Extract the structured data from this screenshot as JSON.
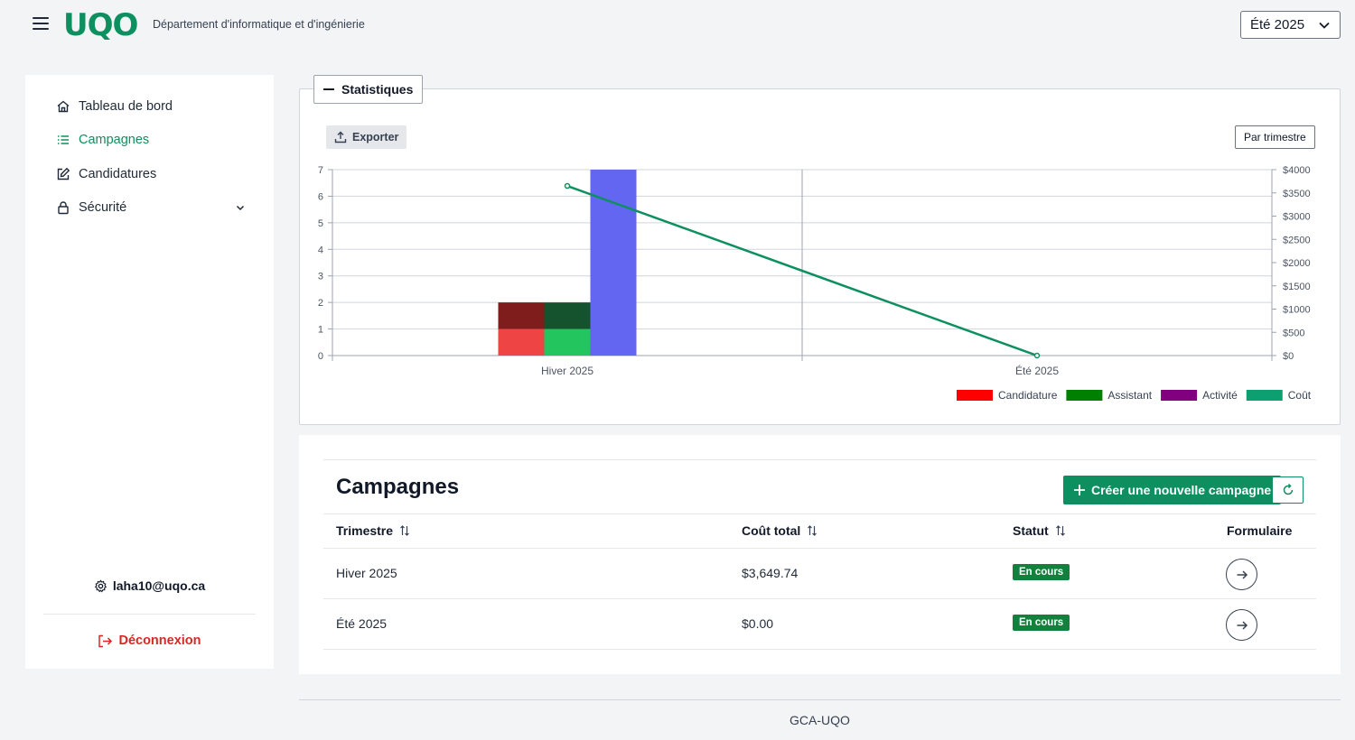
{
  "header": {
    "logo_text": "UQO",
    "department": "Département d'informatique et d'ingénierie",
    "term_selected": "Été 2025"
  },
  "sidebar": {
    "items": [
      {
        "label": "Tableau de bord",
        "icon": "home-icon"
      },
      {
        "label": "Campagnes",
        "icon": "list-icon",
        "active": true
      },
      {
        "label": "Candidatures",
        "icon": "edit-icon"
      },
      {
        "label": "Sécurité",
        "icon": "lock-icon"
      }
    ],
    "user_email": "laha10@uqo.ca",
    "logout_label": "Déconnexion"
  },
  "stats": {
    "legend_label": "Statistiques",
    "export_label": "Exporter",
    "period_label": "Par trimestre"
  },
  "chart_data": {
    "type": "bar",
    "categories": [
      "Hiver 2025",
      "Été 2025"
    ],
    "y_left": {
      "ylim": [
        0,
        7
      ],
      "ticks": [
        "0",
        "1",
        "2",
        "3",
        "4",
        "5",
        "6",
        "7"
      ]
    },
    "y_right": {
      "ylim": [
        0,
        4000
      ],
      "ticks": [
        "$0",
        "$500",
        "$1000",
        "$1500",
        "$2000",
        "$2500",
        "$3000",
        "$3500",
        "$4000"
      ]
    },
    "series": [
      {
        "name": "Candidature",
        "type": "bar",
        "color": "#ef4444",
        "stack": [
          {
            "category": 0,
            "values": [
              1,
              1
            ],
            "colors": [
              "#ef4444",
              "#7f1d1d"
            ]
          }
        ]
      },
      {
        "name": "Assistant",
        "type": "bar",
        "color": "#22c55e",
        "stack": [
          {
            "category": 0,
            "values": [
              1,
              1
            ],
            "colors": [
              "#22c55e",
              "#14532d"
            ]
          }
        ]
      },
      {
        "name": "Activité",
        "type": "bar",
        "color": "#6366f1",
        "values": [
          7,
          0
        ]
      },
      {
        "name": "Coût",
        "type": "line",
        "axis": "right",
        "color": "#0d8f5f",
        "values": [
          3649.74,
          0
        ]
      }
    ],
    "legend": [
      {
        "label": "Candidature",
        "color": "#ff0000"
      },
      {
        "label": "Assistant",
        "color": "#008000"
      },
      {
        "label": "Activité",
        "color": "#800080"
      },
      {
        "label": "Coût",
        "color": "#0d9f6f"
      }
    ],
    "legend_position": "bottom-right",
    "grid": true
  },
  "campaigns": {
    "title": "Campagnes",
    "create_label": "Créer une nouvelle campagne",
    "columns": {
      "trimestre": "Trimestre",
      "cout": "Coût total",
      "statut": "Statut",
      "formulaire": "Formulaire"
    },
    "rows": [
      {
        "trimestre": "Hiver 2025",
        "cout": "$3,649.74",
        "statut": "En cours"
      },
      {
        "trimestre": "Été 2025",
        "cout": "$0.00",
        "statut": "En cours"
      }
    ]
  },
  "footer": {
    "text": "GCA-UQO"
  },
  "colors": {
    "brand": "#0d8f5f",
    "danger": "#dc2626",
    "badge": "#15803d"
  }
}
